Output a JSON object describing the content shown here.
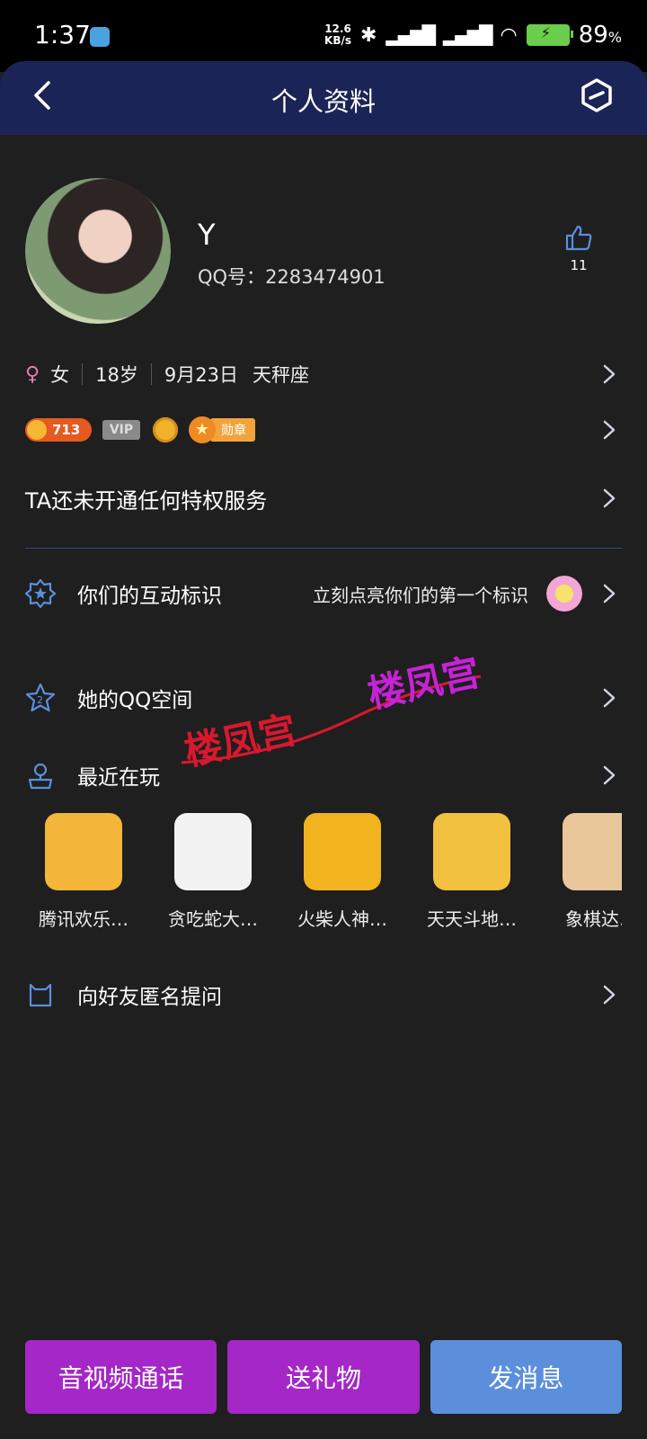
{
  "status_bar": {
    "time": "1:37",
    "net_speed_value": "12.6",
    "net_speed_unit": "KB/s",
    "battery": "89",
    "battery_unit": "%"
  },
  "header": {
    "title": "个人资料"
  },
  "profile": {
    "name": "Y",
    "qq_label": "QQ号：",
    "qq_number": "2283474901",
    "like_count": "11"
  },
  "info": {
    "gender": "女",
    "age": "18岁",
    "birthday": "9月23日",
    "zodiac": "天秤座"
  },
  "badges": {
    "coin": "713",
    "vip": "VIP",
    "medal": "勋章"
  },
  "privilege_text": "TA还未开通任何特权服务",
  "menu": {
    "interaction_label": "你们的互动标识",
    "interaction_hint": "立刻点亮你们的第一个标识",
    "qzone_label": "她的QQ空间",
    "recent_label": "最近在玩",
    "ask_label": "向好友匿名提问"
  },
  "games": [
    {
      "name": "腾讯欢乐…",
      "color": "#f3b63a"
    },
    {
      "name": "贪吃蛇大…",
      "color": "#f2f2f2"
    },
    {
      "name": "火柴人神…",
      "color": "#f1b41e"
    },
    {
      "name": "天天斗地…",
      "color": "#f2c03f"
    },
    {
      "name": "象棋达…",
      "color": "#e9c79b"
    }
  ],
  "watermarks": [
    "楼凤宫",
    "楼凤宫"
  ],
  "buttons": {
    "call": "音视频通话",
    "gift": "送礼物",
    "message": "发消息"
  }
}
